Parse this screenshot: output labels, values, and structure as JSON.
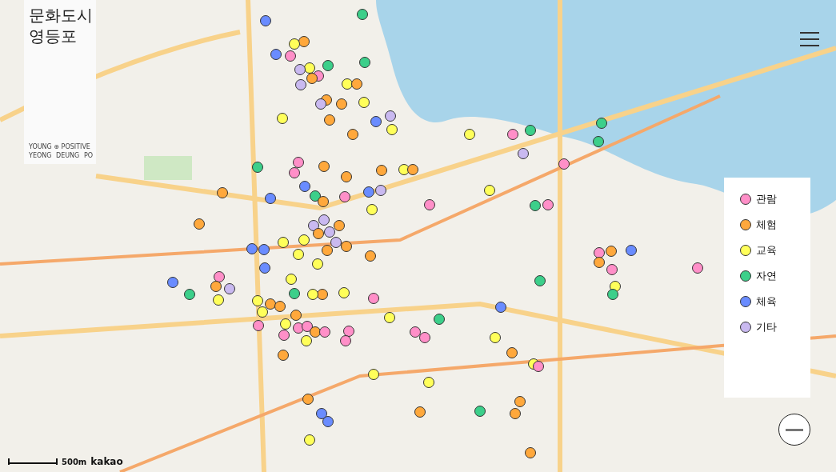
{
  "logo": {
    "title_lines": [
      "문화도시",
      "영등포"
    ],
    "tagline": "YOUNG ⊕ POSITIVE",
    "subline": [
      "YEONG",
      "DEUNG",
      "PO"
    ]
  },
  "legend": [
    {
      "label": "관람",
      "color": "#ff8fc8"
    },
    {
      "label": "체험",
      "color": "#ffa83c"
    },
    {
      "label": "교육",
      "color": "#ffff5a"
    },
    {
      "label": "자연",
      "color": "#3ccf8a"
    },
    {
      "label": "체육",
      "color": "#6a8cff"
    },
    {
      "label": "기타",
      "color": "#c9b9f0"
    }
  ],
  "scale": {
    "label": "500m",
    "brand": "kakao"
  },
  "pins": [
    {
      "color": "#6a8cff"
    },
    {
      "color": "#3ccf8a"
    },
    {
      "color": "#ffa83c"
    },
    {
      "color": "#ffff5a"
    },
    {
      "color": "#6a8cff"
    },
    {
      "color": "#ff8fc8"
    },
    {
      "color": "#ffff5a"
    },
    {
      "color": "#3ccf8a"
    },
    {
      "color": "#3ccf8a"
    },
    {
      "color": "#c9b9f0"
    },
    {
      "color": "#ff8fc8"
    },
    {
      "color": "#c9b9f0"
    },
    {
      "color": "#ffa83c"
    },
    {
      "color": "#ffff5a"
    },
    {
      "color": "#ffa83c"
    },
    {
      "color": "#ffa83c"
    },
    {
      "color": "#c9b9f0"
    },
    {
      "color": "#ffa83c"
    },
    {
      "color": "#ffff5a"
    },
    {
      "color": "#ffff5a"
    },
    {
      "color": "#ffa83c"
    },
    {
      "color": "#c9b9f0"
    },
    {
      "color": "#6a8cff"
    },
    {
      "color": "#ffff5a"
    },
    {
      "color": "#ffa83c"
    },
    {
      "color": "#ffff5a"
    },
    {
      "color": "#ff8fc8"
    },
    {
      "color": "#3ccf8a"
    },
    {
      "color": "#3ccf8a"
    },
    {
      "color": "#3ccf8a"
    },
    {
      "color": "#c9b9f0"
    },
    {
      "color": "#ff8fc8"
    },
    {
      "color": "#3ccf8a"
    },
    {
      "color": "#ff8fc8"
    },
    {
      "color": "#ffa83c"
    },
    {
      "color": "#ff8fc8"
    },
    {
      "color": "#ffa83c"
    },
    {
      "color": "#ffa83c"
    },
    {
      "color": "#ffff5a"
    },
    {
      "color": "#ffa83c"
    },
    {
      "color": "#6a8cff"
    },
    {
      "color": "#6a8cff"
    },
    {
      "color": "#3ccf8a"
    },
    {
      "color": "#ff8fc8"
    },
    {
      "color": "#6a8cff"
    },
    {
      "color": "#c9b9f0"
    },
    {
      "color": "#ffa83c"
    },
    {
      "color": "#ffa83c"
    },
    {
      "color": "#ffff5a"
    },
    {
      "color": "#ffa83c"
    },
    {
      "color": "#ff8fc8"
    },
    {
      "color": "#ffff5a"
    },
    {
      "color": "#3ccf8a"
    },
    {
      "color": "#ff8fc8"
    },
    {
      "color": "#c9b9f0"
    },
    {
      "color": "#c9b9f0"
    },
    {
      "color": "#ffa83c"
    },
    {
      "color": "#c9b9f0"
    },
    {
      "color": "#ffa83c"
    },
    {
      "color": "#ffff5a"
    },
    {
      "color": "#ffff5a"
    },
    {
      "color": "#6a8cff"
    },
    {
      "color": "#6a8cff"
    },
    {
      "color": "#c9b9f0"
    },
    {
      "color": "#ffa83c"
    },
    {
      "color": "#ffa83c"
    },
    {
      "color": "#ffff5a"
    },
    {
      "color": "#ffff5a"
    },
    {
      "color": "#ffa83c"
    },
    {
      "color": "#ff8fc8"
    },
    {
      "color": "#ffa83c"
    },
    {
      "color": "#6a8cff"
    },
    {
      "color": "#ffa83c"
    },
    {
      "color": "#ff8fc8"
    },
    {
      "color": "#ff8fc8"
    },
    {
      "color": "#6a8cff"
    },
    {
      "color": "#ffff5a"
    },
    {
      "color": "#ff8fc8"
    },
    {
      "color": "#c9b9f0"
    },
    {
      "color": "#ffa83c"
    },
    {
      "color": "#6a8cff"
    },
    {
      "color": "#3ccf8a"
    },
    {
      "color": "#ffff5a"
    },
    {
      "color": "#3ccf8a"
    },
    {
      "color": "#ffff5a"
    },
    {
      "color": "#3ccf8a"
    },
    {
      "color": "#ffff5a"
    },
    {
      "color": "#ffa83c"
    },
    {
      "color": "#ffff5a"
    },
    {
      "color": "#3ccf8a"
    },
    {
      "color": "#ff8fc8"
    },
    {
      "color": "#ffff5a"
    },
    {
      "color": "#ffa83c"
    },
    {
      "color": "#ffa83c"
    },
    {
      "color": "#ffff5a"
    },
    {
      "color": "#ffa83c"
    },
    {
      "color": "#ff8fc8"
    },
    {
      "color": "#ffff5a"
    },
    {
      "color": "#ff8fc8"
    },
    {
      "color": "#ff8fc8"
    },
    {
      "color": "#ffa83c"
    },
    {
      "color": "#ff8fc8"
    },
    {
      "color": "#ff8fc8"
    },
    {
      "color": "#ff8fc8"
    },
    {
      "color": "#ffff5a"
    },
    {
      "color": "#3ccf8a"
    },
    {
      "color": "#ff8fc8"
    },
    {
      "color": "#ff8fc8"
    },
    {
      "color": "#ff8fc8"
    },
    {
      "color": "#ffff5a"
    },
    {
      "color": "#6a8cff"
    },
    {
      "color": "#ffff5a"
    },
    {
      "color": "#ffa83c"
    },
    {
      "color": "#ffff5a"
    },
    {
      "color": "#ff8fc8"
    },
    {
      "color": "#ffa83c"
    },
    {
      "color": "#ffff5a"
    },
    {
      "color": "#ffff5a"
    },
    {
      "color": "#ffa83c"
    },
    {
      "color": "#ffa83c"
    },
    {
      "color": "#ffa83c"
    },
    {
      "color": "#6a8cff"
    },
    {
      "color": "#6a8cff"
    },
    {
      "color": "#3ccf8a"
    },
    {
      "color": "#ffa83c"
    },
    {
      "color": "#ffff5a"
    },
    {
      "color": "#ffa83c"
    }
  ]
}
